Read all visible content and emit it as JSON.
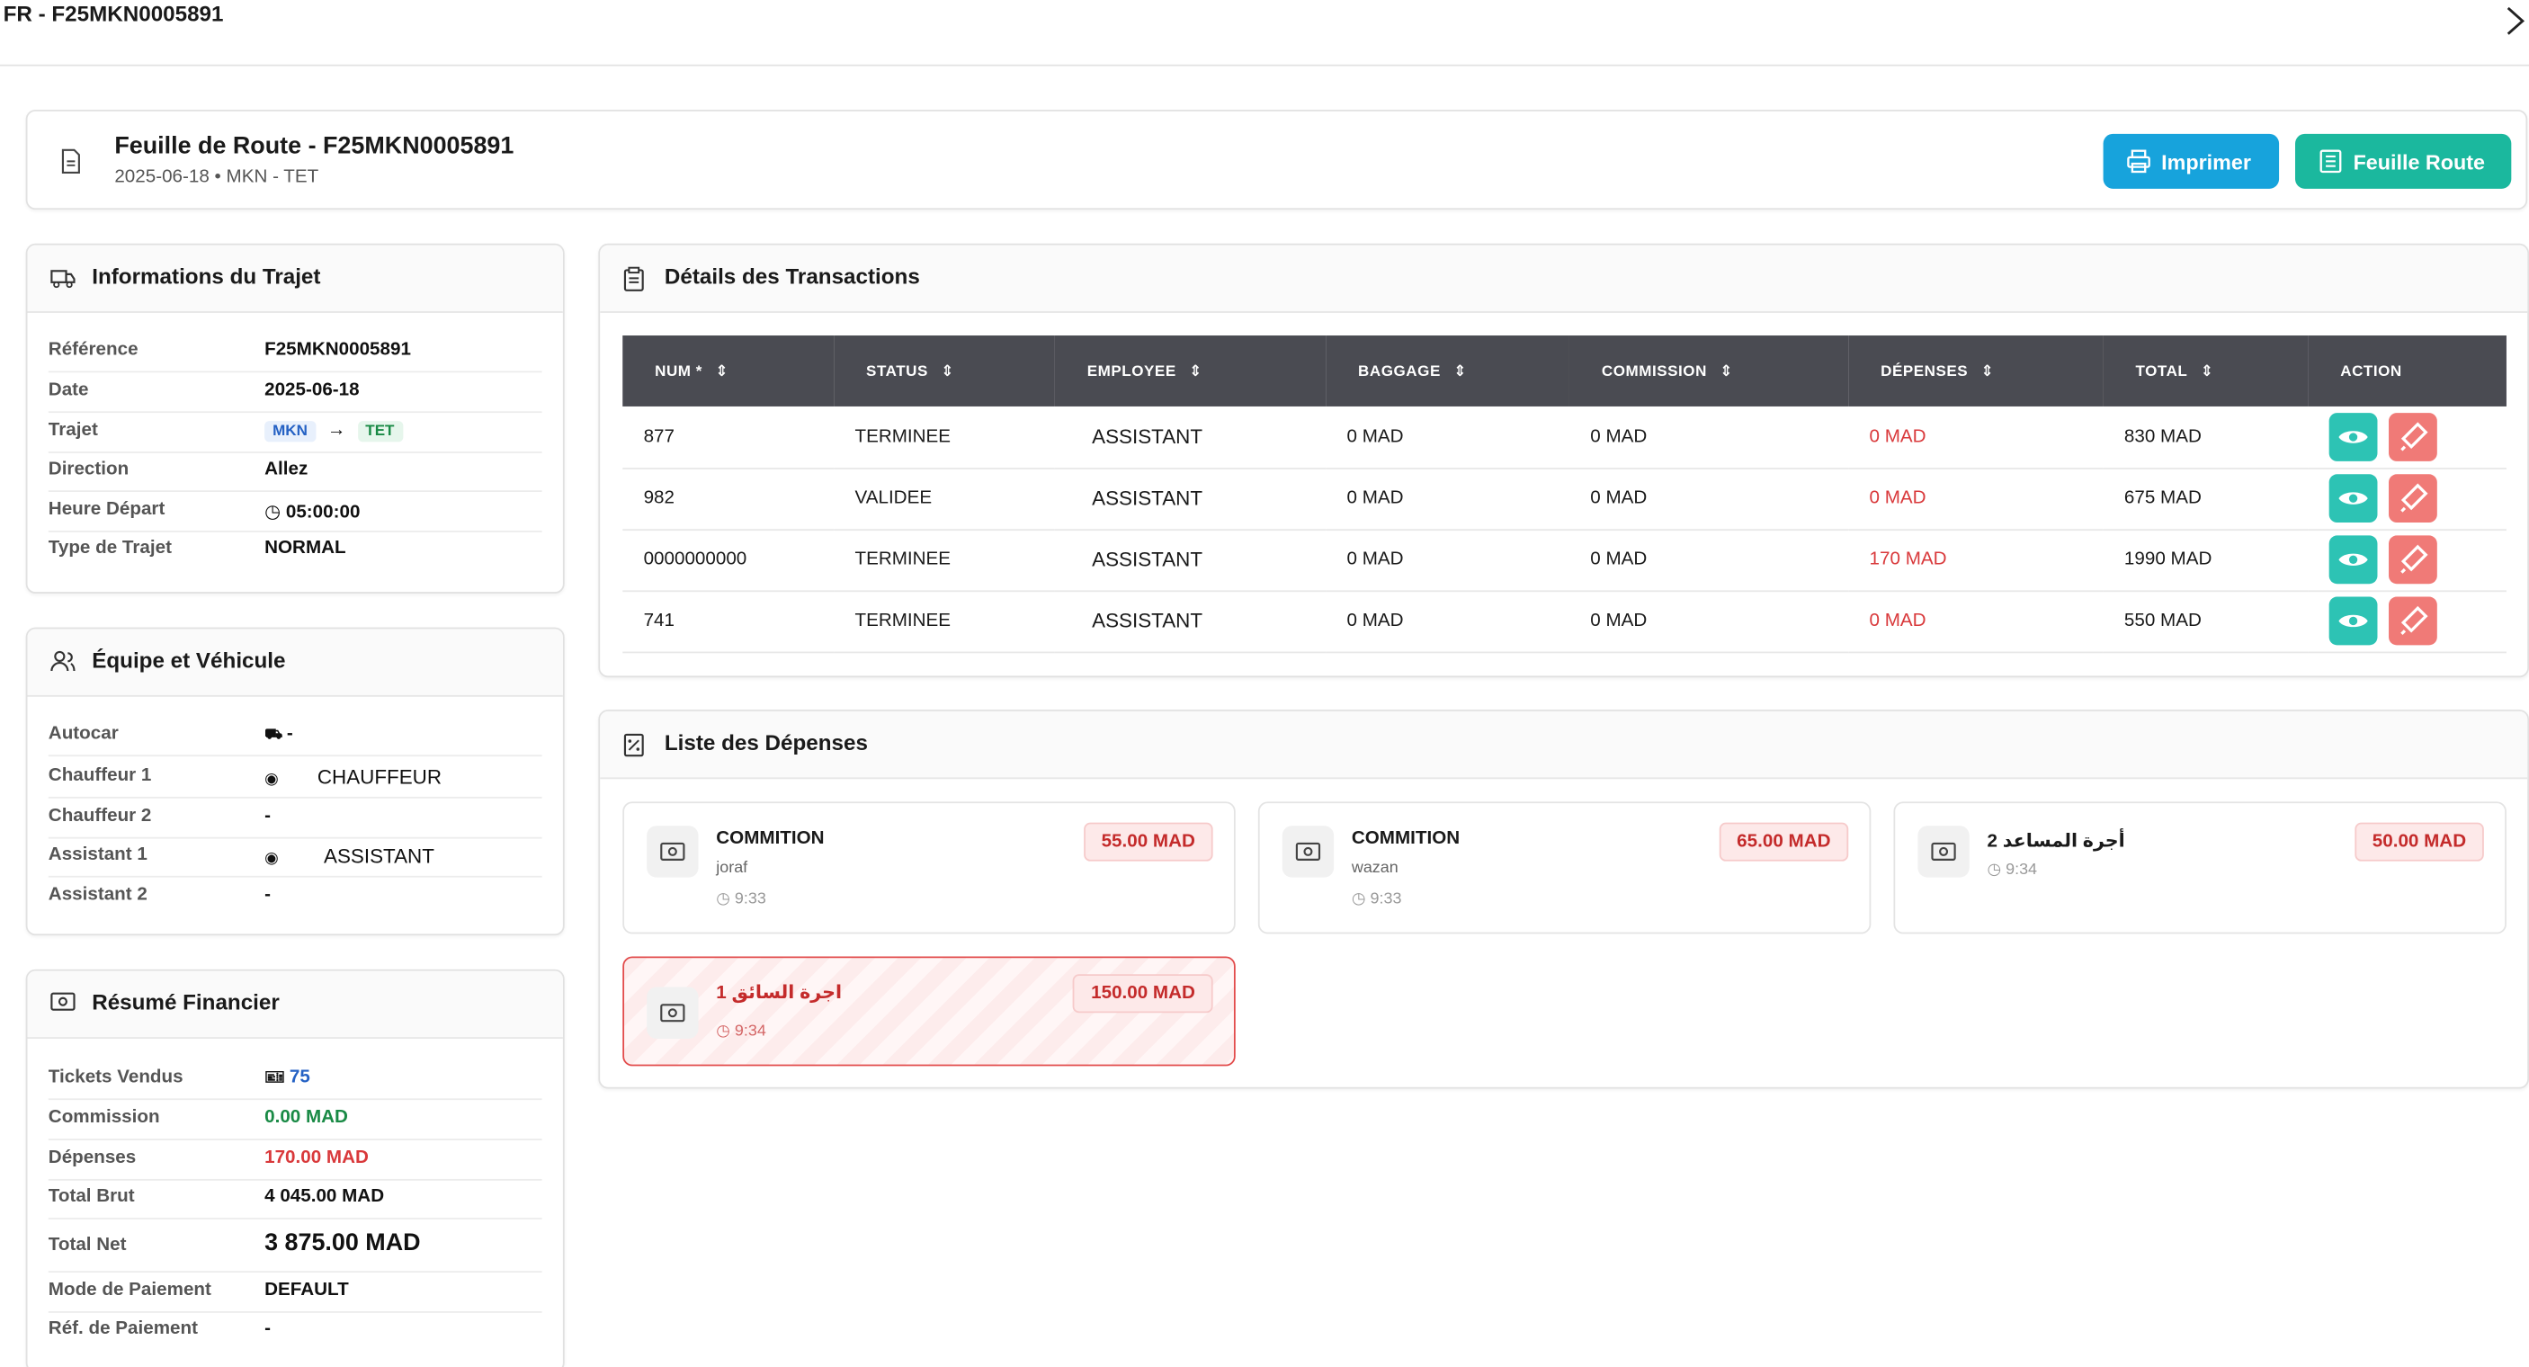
{
  "window": {
    "title": "FR - F25MKN0005891"
  },
  "header": {
    "title": "Feuille de Route - F25MKN0005891",
    "subtitle": "2025-06-18 • MKN - TET",
    "print_label": "Imprimer",
    "route_label": "Feuille Route"
  },
  "trajet": {
    "title": "Informations du Trajet",
    "rows": [
      {
        "k": "Référence",
        "v": "F25MKN0005891"
      },
      {
        "k": "Date",
        "v": "2025-06-18"
      },
      {
        "k": "Trajet",
        "from": "MKN",
        "to": "TET"
      },
      {
        "k": "Direction",
        "v": "Allez"
      },
      {
        "k": "Heure Départ",
        "v": "05:00:00"
      },
      {
        "k": "Type de Trajet",
        "v": "NORMAL"
      }
    ]
  },
  "equipe": {
    "title": "Équipe et Véhicule",
    "rows": [
      {
        "k": "Autocar",
        "v": "-"
      },
      {
        "k": "Chauffeur 1",
        "v": "CHAUFFEUR"
      },
      {
        "k": "Chauffeur 2",
        "v": "-"
      },
      {
        "k": "Assistant 1",
        "v": "ASSISTANT"
      },
      {
        "k": "Assistant 2",
        "v": "-"
      }
    ]
  },
  "resume": {
    "title": "Résumé Financier",
    "rows": [
      {
        "k": "Tickets Vendus",
        "v": "75"
      },
      {
        "k": "Commission",
        "v": "0.00 MAD"
      },
      {
        "k": "Dépenses",
        "v": "170.00 MAD"
      },
      {
        "k": "Total Brut",
        "v": "4 045.00 MAD"
      },
      {
        "k": "Total Net",
        "v": "3 875.00 MAD"
      },
      {
        "k": "Mode de Paiement",
        "v": "DEFAULT"
      },
      {
        "k": "Réf. de Paiement",
        "v": "-"
      }
    ]
  },
  "transactions": {
    "title": "Détails des Transactions",
    "columns": [
      "NUM *",
      "STATUS",
      "EMPLOYEE",
      "BAGGAGE",
      "COMMISSION",
      "DÉPENSES",
      "TOTAL",
      "ACTION"
    ],
    "rows": [
      [
        "877",
        "TERMINEE",
        "ASSISTANT",
        "0 MAD",
        "0 MAD",
        "0 MAD",
        "830 MAD"
      ],
      [
        "982",
        "VALIDEE",
        "ASSISTANT",
        "0 MAD",
        "0 MAD",
        "0 MAD",
        "675 MAD"
      ],
      [
        "0000000000",
        "TERMINEE",
        "ASSISTANT",
        "0 MAD",
        "0 MAD",
        "170 MAD",
        "1990 MAD"
      ],
      [
        "741",
        "TERMINEE",
        "ASSISTANT",
        "0 MAD",
        "0 MAD",
        "0 MAD",
        "550 MAD"
      ]
    ]
  },
  "depenses": {
    "title": "Liste des Dépenses",
    "items": [
      {
        "name": "COMMITION",
        "sub": "joraf",
        "time": "9:33",
        "amount": "55.00 MAD"
      },
      {
        "name": "COMMITION",
        "sub": "wazan",
        "time": "9:33",
        "amount": "65.00 MAD"
      },
      {
        "name": "أجرة المساعد 2",
        "sub": "",
        "time": "9:34",
        "amount": "50.00 MAD"
      },
      {
        "name": "اجرة السائق 1",
        "sub": "",
        "time": "9:34",
        "amount": "150.00 MAD"
      }
    ]
  },
  "colors": {
    "blue": "#17a3dc",
    "teal": "#1bb89e",
    "red": "#d9393b",
    "header_dark": "#4a4b52"
  }
}
